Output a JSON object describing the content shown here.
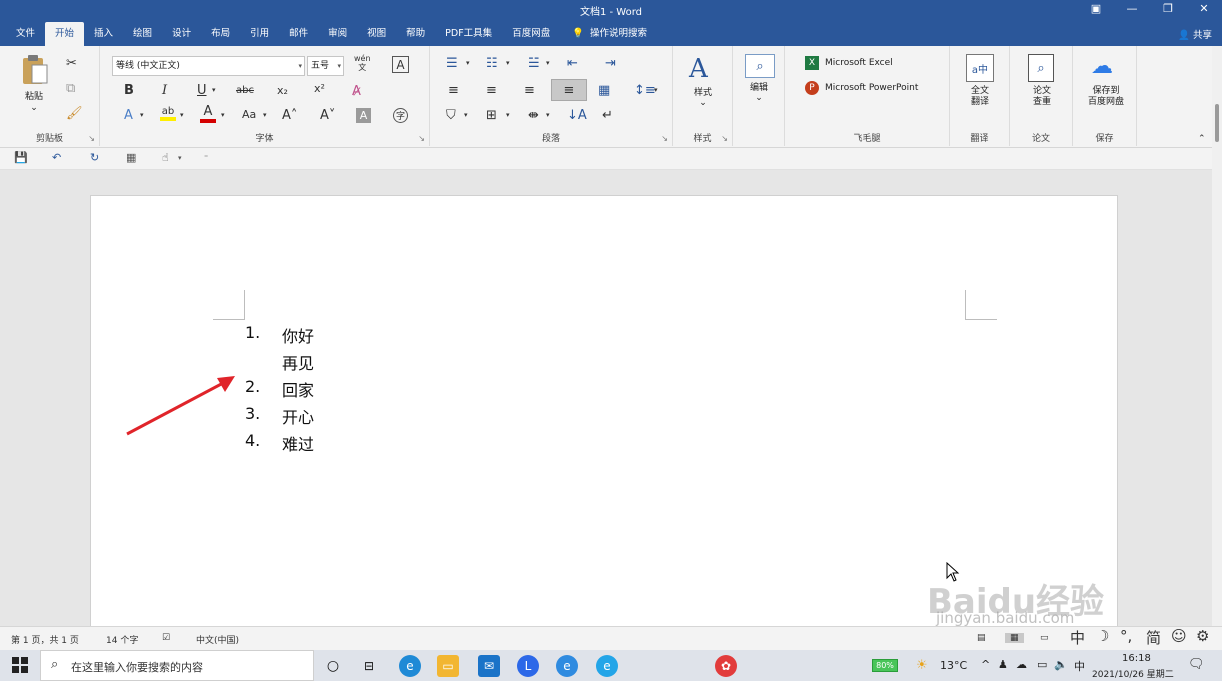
{
  "window": {
    "title": "文档1 - Word",
    "controls": [
      "▣",
      "—",
      "❐",
      "✕"
    ]
  },
  "tabs": [
    "文件",
    "开始",
    "插入",
    "绘图",
    "设计",
    "布局",
    "引用",
    "邮件",
    "审阅",
    "视图",
    "帮助",
    "PDF工具集",
    "百度网盘"
  ],
  "tell_me": "操作说明搜索",
  "share": "共享",
  "ribbon": {
    "clipboard": {
      "label": "剪贴板",
      "paste": "粘贴"
    },
    "font": {
      "label": "字体",
      "family": "等线 (中文正文)",
      "size": "五号",
      "wen": "wén",
      "wen_char": "文"
    },
    "paragraph": {
      "label": "段落"
    },
    "styles": {
      "label": "样式",
      "styles_btn": "样式",
      "edit_btn": "编辑"
    },
    "feimao": {
      "label": "飞毛腿",
      "excel": "Microsoft Excel",
      "ppt": "Microsoft PowerPoint"
    },
    "translate": {
      "label": "翻译",
      "full": "全文\n翻译"
    },
    "paper": {
      "label": "论文",
      "check": "论文\n查重"
    },
    "save": {
      "label": "保存",
      "baidu": "保存到\n百度网盘"
    }
  },
  "document": {
    "list": [
      {
        "num": "1.",
        "text": "你好"
      },
      {
        "num": "",
        "text": "再见"
      },
      {
        "num": "2.",
        "text": "回家"
      },
      {
        "num": "3.",
        "text": "开心"
      },
      {
        "num": "4.",
        "text": "难过"
      }
    ]
  },
  "watermark": {
    "brand": "Baidu经验",
    "url": "jingyan.baidu.com"
  },
  "status": {
    "page": "第 1 页，共 1 页",
    "words": "14 个字",
    "lang": "中文(中国)"
  },
  "ime": [
    "中",
    "☽",
    "°,",
    "简",
    "☺",
    "⚙"
  ],
  "taskbar": {
    "search_placeholder": "在这里输入你要搜索的内容",
    "battery": "80%",
    "weather": "13°C",
    "ime": "中",
    "time": "16:18",
    "date": "2021/10/26 星期二"
  },
  "colors": {
    "accent": "#2b579a",
    "arrow": "#e0242a"
  }
}
